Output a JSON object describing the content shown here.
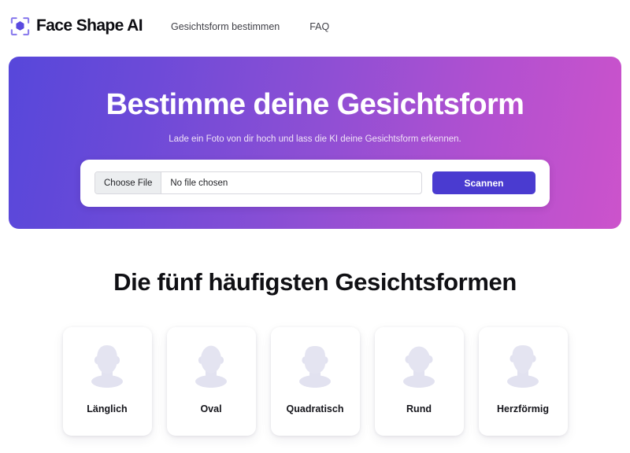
{
  "header": {
    "brand": {
      "logo_icon": "face-scan-hexagon-icon",
      "name": "Face Shape AI",
      "accent_color": "#5a4ae0"
    },
    "nav": [
      {
        "label": "Gesichtsform bestimmen"
      },
      {
        "label": "FAQ"
      }
    ]
  },
  "hero": {
    "title": "Bestimme deine Gesichtsform",
    "subtitle": "Lade ein Foto von dir hoch und lass die KI deine Gesichtsform erkennen.",
    "gradient_from": "#5747da",
    "gradient_to": "#cc53cb",
    "upload": {
      "choose_file_label": "Choose File",
      "file_status": "No file chosen",
      "scan_button_label": "Scannen",
      "scan_button_color": "#4a3bd0"
    }
  },
  "shapes": {
    "section_title": "Die fünf häufigsten Gesichtsformen",
    "silhouette_color": "#e2e2f0",
    "cards": [
      {
        "label": "Länglich",
        "icon": "face-silhouette-oblong-icon"
      },
      {
        "label": "Oval",
        "icon": "face-silhouette-oval-icon"
      },
      {
        "label": "Quadratisch",
        "icon": "face-silhouette-square-icon"
      },
      {
        "label": "Rund",
        "icon": "face-silhouette-round-icon"
      },
      {
        "label": "Herzförmig",
        "icon": "face-silhouette-heart-icon"
      }
    ]
  }
}
